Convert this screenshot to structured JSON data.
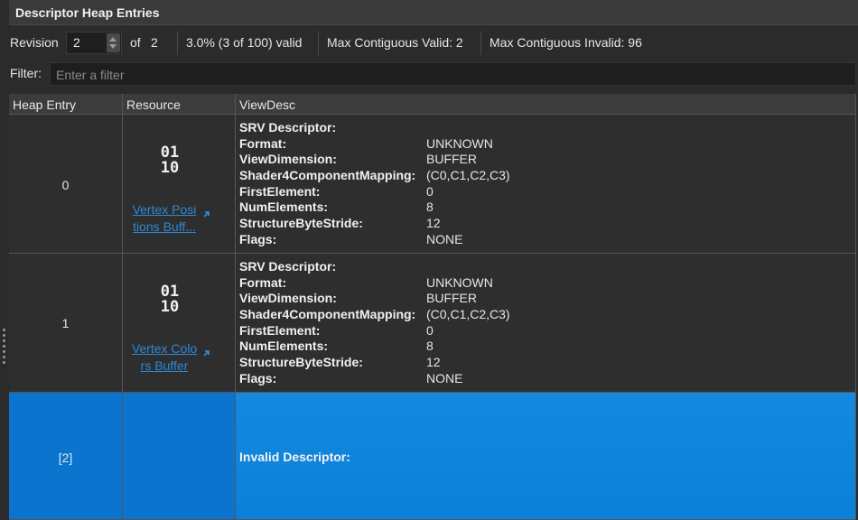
{
  "panel": {
    "title": "Descriptor Heap Entries"
  },
  "toolbar": {
    "revision_label": "Revision",
    "revision_value": "2",
    "of_label": "of",
    "revision_total": "2",
    "valid_summary": "3.0% (3 of 100) valid",
    "max_contiguous_valid": "Max Contiguous Valid: 2",
    "max_contiguous_invalid": "Max Contiguous Invalid: 96"
  },
  "filter": {
    "label": "Filter:",
    "placeholder": "Enter a filter"
  },
  "columns": [
    "Heap Entry",
    "Resource",
    "ViewDesc"
  ],
  "rows": [
    {
      "entry": "0",
      "resource_icon": "01\n10",
      "resource_link": "Vertex Posi tions Buff...",
      "link_line1": "Vertex Posi",
      "link_line2": "tions Buff...",
      "desc_title": "SRV Descriptor:",
      "fields": [
        {
          "k": "Format:",
          "v": "UNKNOWN"
        },
        {
          "k": "ViewDimension:",
          "v": "BUFFER"
        },
        {
          "k": "Shader4ComponentMapping:",
          "v": "(C0,C1,C2,C3)"
        },
        {
          "k": "FirstElement:",
          "v": "0"
        },
        {
          "k": "NumElements:",
          "v": "8"
        },
        {
          "k": "StructureByteStride:",
          "v": "12"
        },
        {
          "k": "Flags:",
          "v": "NONE"
        }
      ]
    },
    {
      "entry": "1",
      "resource_icon": "01\n10",
      "link_line1": "Vertex Colo",
      "link_line2": "rs Buffer",
      "desc_title": "SRV Descriptor:",
      "fields": [
        {
          "k": "Format:",
          "v": "UNKNOWN"
        },
        {
          "k": "ViewDimension:",
          "v": "BUFFER"
        },
        {
          "k": "Shader4ComponentMapping:",
          "v": "(C0,C1,C2,C3)"
        },
        {
          "k": "FirstElement:",
          "v": "0"
        },
        {
          "k": "NumElements:",
          "v": "8"
        },
        {
          "k": "StructureByteStride:",
          "v": "12"
        },
        {
          "k": "Flags:",
          "v": "NONE"
        }
      ]
    },
    {
      "entry": "[2]",
      "desc_title": "Invalid Descriptor:"
    }
  ],
  "colors": {
    "selection": "#0a74cf",
    "link": "#2d88d6",
    "background": "#2b2b2b"
  },
  "icons": {
    "buffer": "binary-buffer-icon",
    "link_arrow": "external-link-arrow-icon",
    "spinner": "spinner-arrows-icon"
  }
}
